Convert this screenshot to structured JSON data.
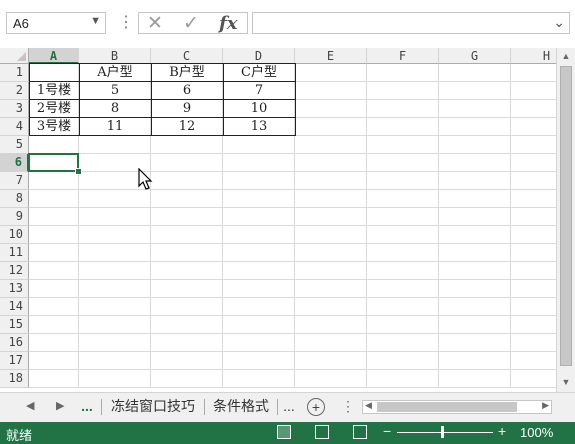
{
  "namebox": {
    "value": "A6"
  },
  "formula_bar": {
    "cancel_icon": "✕",
    "enter_icon": "✓",
    "fx_label": "fx",
    "value": ""
  },
  "columns": [
    "A",
    "B",
    "C",
    "D",
    "E",
    "F",
    "G",
    "H"
  ],
  "rows": [
    "1",
    "2",
    "3",
    "4",
    "5",
    "6",
    "7",
    "8",
    "9",
    "10",
    "11",
    "12",
    "13",
    "14",
    "15",
    "16",
    "17",
    "18"
  ],
  "selected": {
    "column": "A",
    "row": "6"
  },
  "table": [
    [
      "",
      "A户型",
      "B户型",
      "C户型"
    ],
    [
      "1号楼",
      "5",
      "6",
      "7"
    ],
    [
      "2号楼",
      "8",
      "9",
      "10"
    ],
    [
      "3号楼",
      "11",
      "12",
      "13"
    ]
  ],
  "sheet_tabs": {
    "overflow_left": "...",
    "tabs": [
      "冻结窗口技巧",
      "条件格式"
    ],
    "overflow_right": "...",
    "active_index": -1
  },
  "status": {
    "mode": "就绪",
    "zoom": "100%",
    "zoom_fraction": 0.5
  },
  "colors": {
    "accent": "#217346",
    "header_bg": "#f0f0f0",
    "gridline": "#dadada"
  }
}
